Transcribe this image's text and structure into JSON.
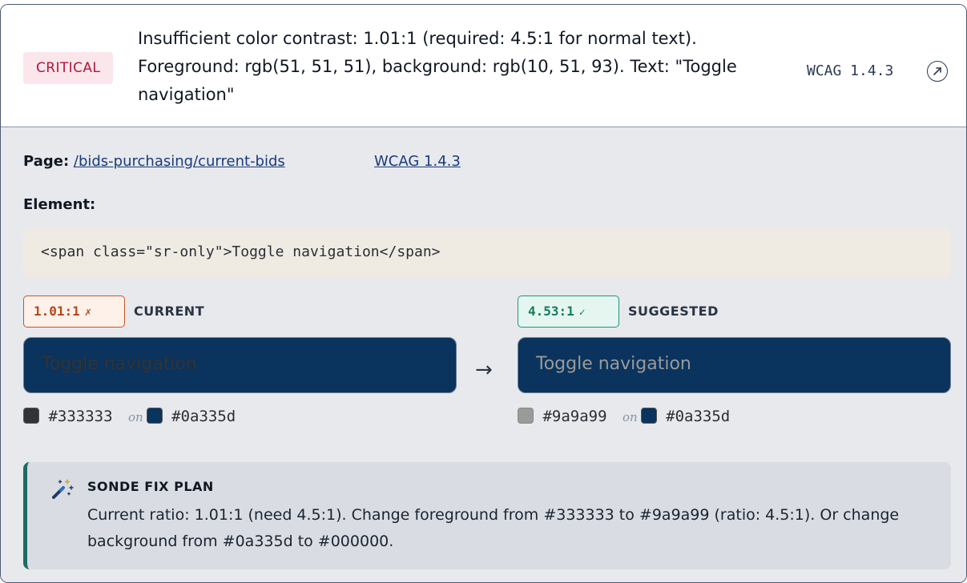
{
  "issue": {
    "severity": "CRITICAL",
    "message": "Insufficient color contrast: 1.01:1 (required: 4.5:1 for normal text). Foreground: rgb(51, 51, 51), background: rgb(10, 51, 93). Text: \"Toggle navigation\"",
    "wcag": "WCAG 1.4.3",
    "link_icon": "external-link-icon"
  },
  "details": {
    "page_label": "Page:",
    "page_path": "/bids-purchasing/current-bids",
    "wcag_link": "WCAG 1.4.3",
    "element_label": "Element:",
    "element_code": "<span class=\"sr-only\">Toggle navigation</span>"
  },
  "current": {
    "ratio": "1.01:1",
    "ratio_mark": "✗",
    "label": "CURRENT",
    "preview_text": "Toggle navigation",
    "fg": "#333333",
    "on": "on",
    "bg": "#0a335d"
  },
  "suggested": {
    "ratio": "4.53:1",
    "ratio_mark": "✓",
    "label": "SUGGESTED",
    "preview_text": "Toggle navigation",
    "fg": "#9a9a99",
    "on": "on",
    "bg": "#0a335d"
  },
  "arrow": "→",
  "fix_plan": {
    "icon": "magic-wand-icon",
    "title": "SONDE FIX PLAN",
    "text": "Current ratio: 1.01:1 (need 4.5:1). Change foreground from #333333 to #9a9a99 (ratio: 4.5:1). Or change background from #0a335d to #000000."
  },
  "colors": {
    "critical": "#b0173a",
    "bad_ratio": "#b8461c",
    "good_ratio": "#157b61",
    "fix_accent": "#1e6b63"
  }
}
